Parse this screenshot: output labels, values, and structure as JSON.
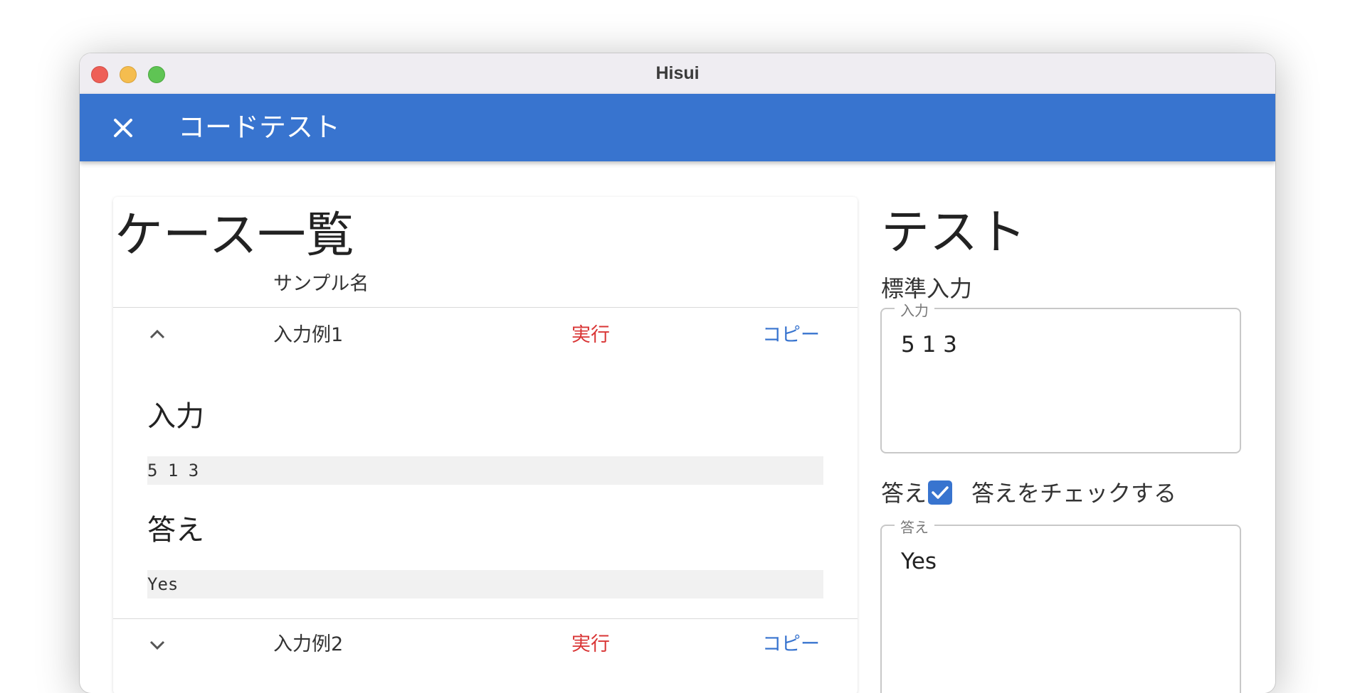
{
  "window": {
    "title": "Hisui"
  },
  "appbar": {
    "title": "コードテスト",
    "close_icon": "close-icon"
  },
  "cases": {
    "heading": "ケース一覧",
    "column_header": "サンプル名",
    "items": [
      {
        "label": "入力例1",
        "expanded": true,
        "run_label": "実行",
        "copy_label": "コピー",
        "input_heading": "入力",
        "input_value": "5 1 3",
        "answer_heading": "答え",
        "answer_value": "Yes"
      },
      {
        "label": "入力例2",
        "expanded": false,
        "run_label": "実行",
        "copy_label": "コピー"
      }
    ]
  },
  "test": {
    "heading": "テスト",
    "stdin_label": "標準入力",
    "input_legend": "入力",
    "input_value": "5 1 3",
    "answer_label": "答え",
    "check_answer": true,
    "check_label": "答えをチェックする",
    "answer_legend": "答え",
    "answer_value": "Yes"
  },
  "colors": {
    "accent": "#3874cf",
    "run": "#d93535",
    "copy": "#3874cf"
  }
}
